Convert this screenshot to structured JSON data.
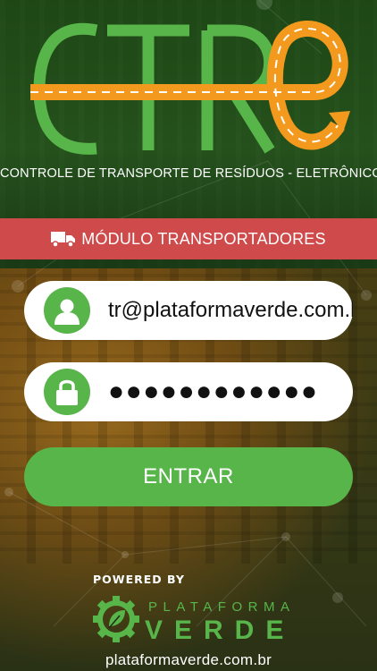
{
  "colors": {
    "brand_green": "#58b54a",
    "road_orange": "#f39a1e",
    "banner_red": "#cf4a4a",
    "field_bg": "#ffffff"
  },
  "logo": {
    "letters": "CTRe",
    "subtitle": "Controle de Transporte de Resíduos - Eletrônico"
  },
  "module": {
    "icon": "truck-icon",
    "label": "MÓDULO TRANSPORTADORES"
  },
  "login": {
    "email_value": "tr@plataformaverde.com.br",
    "email_icon": "user-icon",
    "password_value": "●●●●●●●●●●●●",
    "password_icon": "lock-icon",
    "submit_label": "ENTRAR"
  },
  "footer": {
    "powered_by": "POWERED BY",
    "brand_top": "PLATAFORMA",
    "brand_bottom": "VERDE",
    "url": "plataformaverde.com.br"
  }
}
